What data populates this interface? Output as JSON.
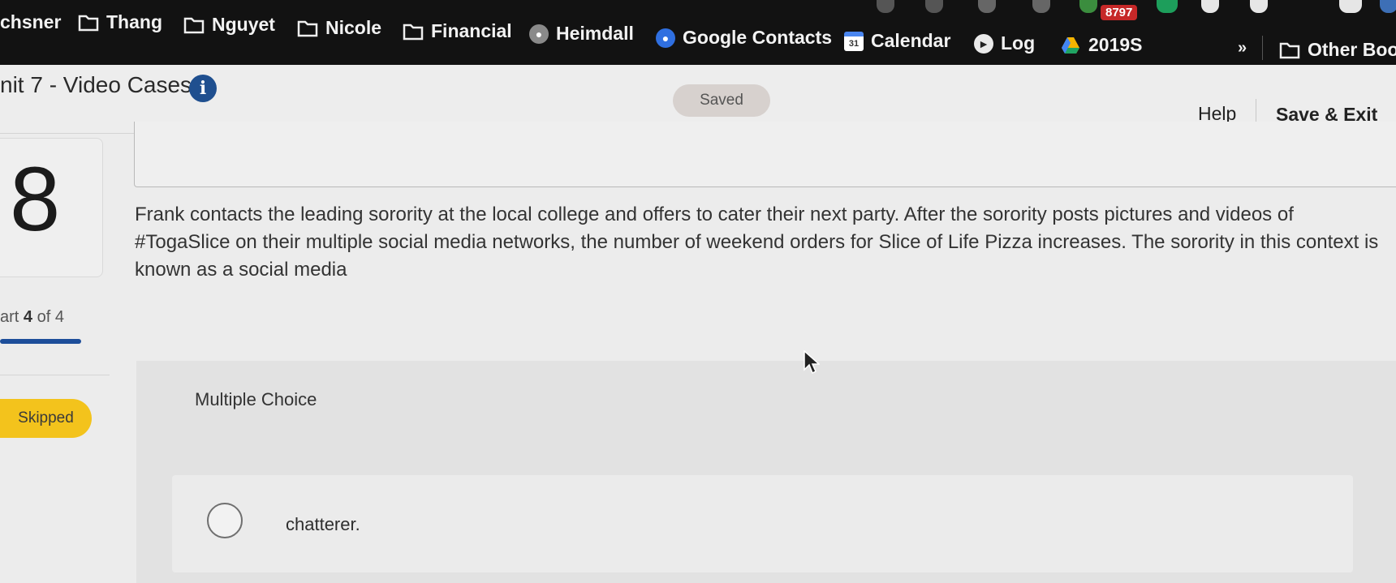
{
  "bookmarks": [
    {
      "label": "chsner",
      "icon": "none"
    },
    {
      "label": "Thang",
      "icon": "folder-icon"
    },
    {
      "label": "Nguyet",
      "icon": "folder-icon"
    },
    {
      "label": "Nicole",
      "icon": "folder-icon"
    },
    {
      "label": "Financial",
      "icon": "folder-icon"
    },
    {
      "label": "Heimdall",
      "icon": "helmet-icon"
    },
    {
      "label": "Google Contacts",
      "icon": "contacts-icon"
    },
    {
      "label": "Calendar",
      "icon": "calendar-icon",
      "icon_text": "31"
    },
    {
      "label": "Log",
      "icon": "globe-icon"
    },
    {
      "label": "2019S",
      "icon": "drive-icon"
    }
  ],
  "more_bookmarks": "»",
  "other_bookmarks": "Other Boo",
  "extension_badge": "8797",
  "header": {
    "title": "nit 7 - Video Cases",
    "info_icon": "i",
    "saved_label": "Saved",
    "help_label": "Help",
    "save_exit_label": "Save & Exit"
  },
  "question": {
    "number": "8",
    "text": "Frank contacts the leading sorority at the local college and offers to cater their next party. After the sorority posts pictures and videos of #TogaSlice on their multiple social media networks, the number of weekend orders for Slice of Life Pizza increases. The sorority in this context is known as a social media",
    "part_prefix": "art",
    "part_current": "4",
    "part_of": "of 4",
    "progress_fraction": 1.0,
    "status": "Skipped"
  },
  "answer": {
    "type_label": "Multiple Choice",
    "options": [
      "chatterer."
    ]
  },
  "colors": {
    "bookmark_bar": "#121212",
    "accent_blue": "#1f4f8f",
    "skipped_yellow": "#f3c31c",
    "badge_red": "#c62828"
  }
}
